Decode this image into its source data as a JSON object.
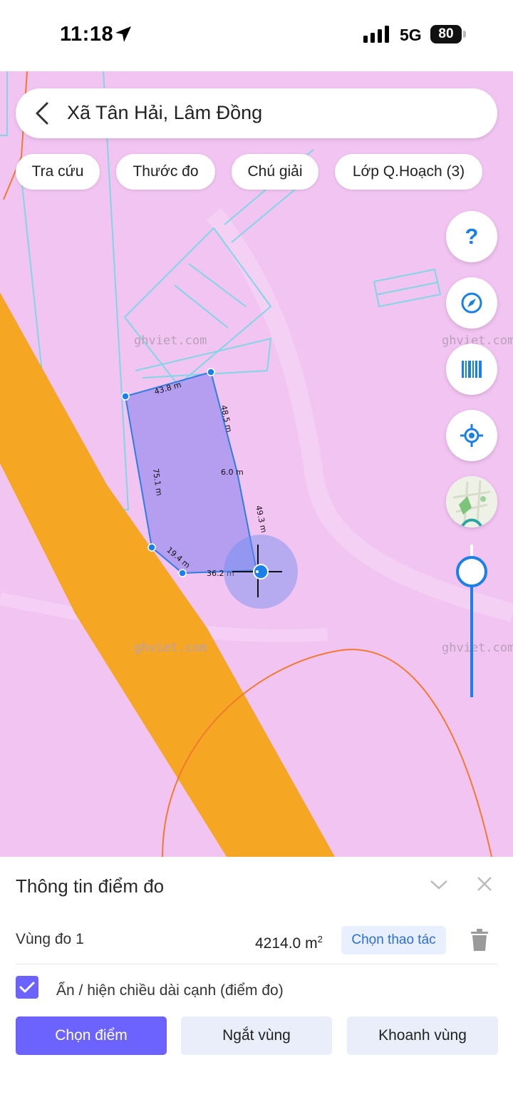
{
  "status_bar": {
    "time": "11:18",
    "network": "5G",
    "battery": "80"
  },
  "search": {
    "text": "Xã Tân Hải, Lâm Đồng"
  },
  "chips": [
    {
      "label": "Tra cứu"
    },
    {
      "label": "Thước đo"
    },
    {
      "label": "Chú giải"
    },
    {
      "label": "Lớp Q.Hoạch (3)"
    }
  ],
  "map": {
    "watermark": "ghviet.com",
    "measurements": {
      "top": "43.8 m",
      "right_upper": "48.5 m",
      "right_small": "6.0 m",
      "right_lower": "49.3 m",
      "left": "75.1 m",
      "bottom_left": "19.4 m",
      "bottom": "36.2 m"
    },
    "fab_help_label": "?",
    "icons": [
      "help-icon",
      "compass-icon",
      "barcode-icon",
      "locate-icon",
      "map-layer-icon"
    ],
    "colors": {
      "zone_pink": "#f2c4f2",
      "road_orange": "#f5a623",
      "polygon_fill": "#9b8ff0",
      "accent": "#1a7fe6"
    }
  },
  "panel": {
    "title": "Thông tin điểm đo",
    "zone_label": "Vùng đo 1",
    "zone_area": "4214.0 m",
    "zone_area_unit_sup": "2",
    "action_label": "Chọn thao tác",
    "toggle_label": "Ẩn / hiện chiều dài cạnh (điểm đo)",
    "toggle_checked": true,
    "buttons": {
      "select_point": "Chọn điểm",
      "break_zone": "Ngắt vùng",
      "zone_area_tool": "Khoanh vùng"
    }
  }
}
